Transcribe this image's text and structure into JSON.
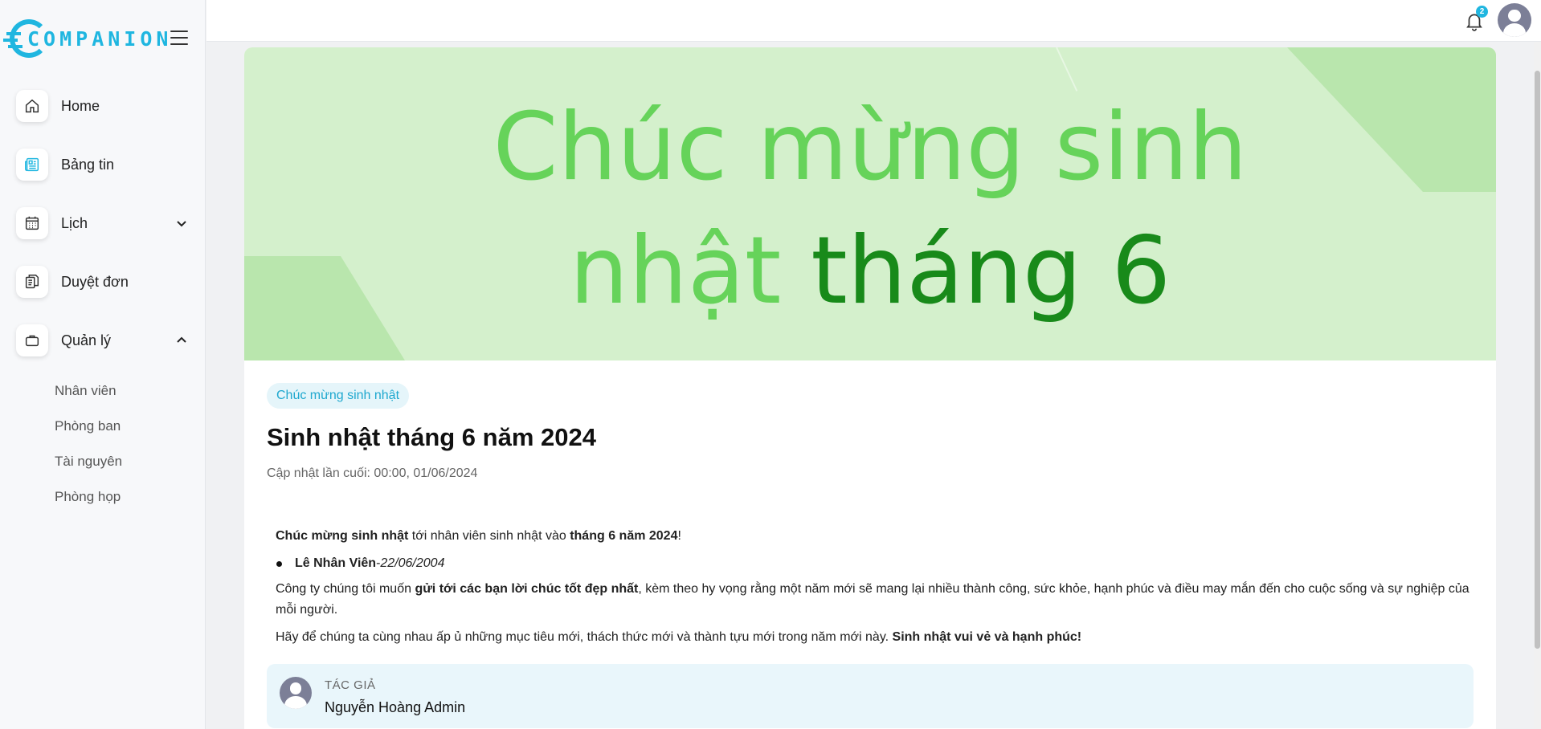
{
  "brand": {
    "logo_text": "COMPANION"
  },
  "sidebar": {
    "items": [
      {
        "label": "Home",
        "icon": "home-icon"
      },
      {
        "label": "Bảng tin",
        "icon": "newspaper-icon"
      },
      {
        "label": "Lịch",
        "icon": "calendar-icon",
        "chevron": "down"
      },
      {
        "label": "Duyệt đơn",
        "icon": "documents-icon"
      },
      {
        "label": "Quản lý",
        "icon": "briefcase-icon",
        "chevron": "up"
      }
    ],
    "sub_items": [
      "Nhân viên",
      "Phòng ban",
      "Tài nguyên",
      "Phòng họp"
    ]
  },
  "topbar": {
    "notification_count": "2"
  },
  "banner": {
    "line1": "Chúc mừng sinh",
    "line2_light": "nhật ",
    "line2_dark": "tháng 6"
  },
  "post": {
    "tag": "Chúc mừng sinh nhật",
    "title": "Sinh nhật tháng 6 năm 2024",
    "updated": "Cập nhật lần cuối: 00:00, 01/06/2024",
    "intro_bold1": "Chúc mừng sinh nhật",
    "intro_text": " tới nhân viên sinh nhật vào ",
    "intro_bold2": "tháng 6 năm 2024",
    "intro_end": "!",
    "bullet_name": "Lê Nhân Viên",
    "bullet_sep": " - ",
    "bullet_date": "22/06/2004",
    "para2_start": "Công ty chúng tôi muốn ",
    "para2_bold": "gửi tới các bạn lời chúc tốt đẹp nhất",
    "para2_end": ", kèm theo hy vọng rằng một năm mới sẽ mang lại nhiều thành công, sức khỏe, hạnh phúc và điều may mắn đến cho cuộc sống và sự nghiệp của mỗi người.",
    "para3_start": "Hãy để chúng ta cùng nhau ấp ủ những mục tiêu mới, thách thức mới và thành tựu mới trong năm mới này. ",
    "para3_bold": "Sinh nhật vui vẻ và hạnh phúc!"
  },
  "author": {
    "label": "TÁC GIẢ",
    "name": "Nguyễn Hoàng Admin"
  },
  "colors": {
    "accent": "#1fb6e0",
    "banner_bg": "#d4f0cc",
    "banner_light": "#66d35a",
    "banner_dark": "#188a1a"
  }
}
